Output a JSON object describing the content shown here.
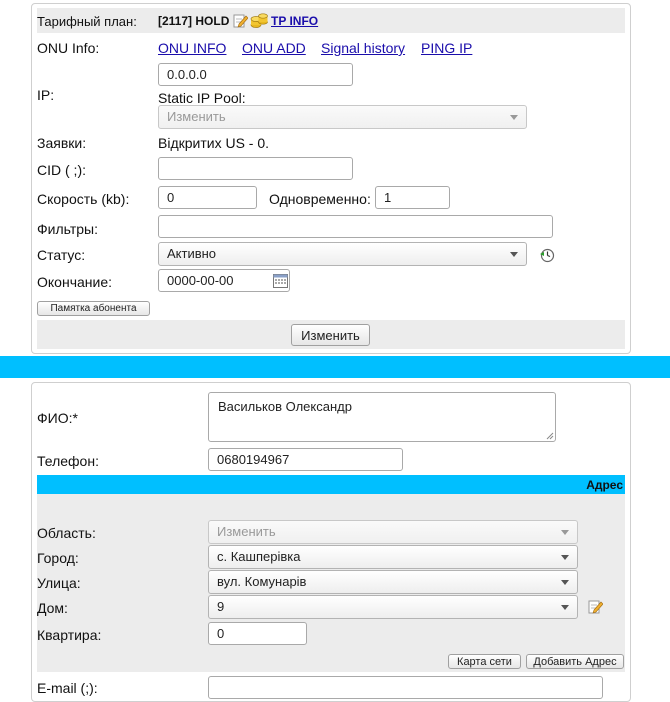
{
  "tariff": {
    "label": "Тарифный план:",
    "value": "[2117] HOLD",
    "link": "TP INFO"
  },
  "onu": {
    "label": "ONU Info:",
    "links": [
      "ONU INFO",
      "ONU ADD",
      "Signal history",
      "PING IP"
    ]
  },
  "ip": {
    "label": "IP:",
    "value": "0.0.0.0",
    "pool_label": "Static IP Pool:",
    "pool_select": "Изменить"
  },
  "requests": {
    "label": "Заявки:",
    "value": "Відкритих US - 0."
  },
  "cid": {
    "label": "CID ( ;):",
    "value": ""
  },
  "speed": {
    "label": "Скорость (kb):",
    "value": "0",
    "simultaneous_label": "Одновременно:",
    "simultaneous_value": "1"
  },
  "filters": {
    "label": "Фильтры:",
    "value": ""
  },
  "status": {
    "label": "Статус:",
    "value": "Активно"
  },
  "expiry": {
    "label": "Окончание:",
    "value": "0000-00-00"
  },
  "memo_button": "Памятка абонента",
  "change_button": "Изменить",
  "person": {
    "fio_label": "ФИО:*",
    "fio_value": "Васильков Олександр",
    "phone_label": "Телефон:",
    "phone_value": "0680194967"
  },
  "address": {
    "header": "Адрес",
    "region_label": "Область:",
    "region_value": "Изменить",
    "city_label": "Город:",
    "city_value": "с. Кашперівка",
    "street_label": "Улица:",
    "street_value": "вул. Комунарів",
    "house_label": "Дом:",
    "house_value": "9",
    "apartment_label": "Квартира:",
    "apartment_value": "0",
    "map_button": "Карта сети",
    "add_address_button": "Добавить Адрес"
  },
  "email": {
    "label": "E-mail (;):",
    "value": ""
  },
  "colors": {
    "accent": "#00bfff",
    "link": "#1a0dab",
    "row_gray": "#ececec"
  }
}
